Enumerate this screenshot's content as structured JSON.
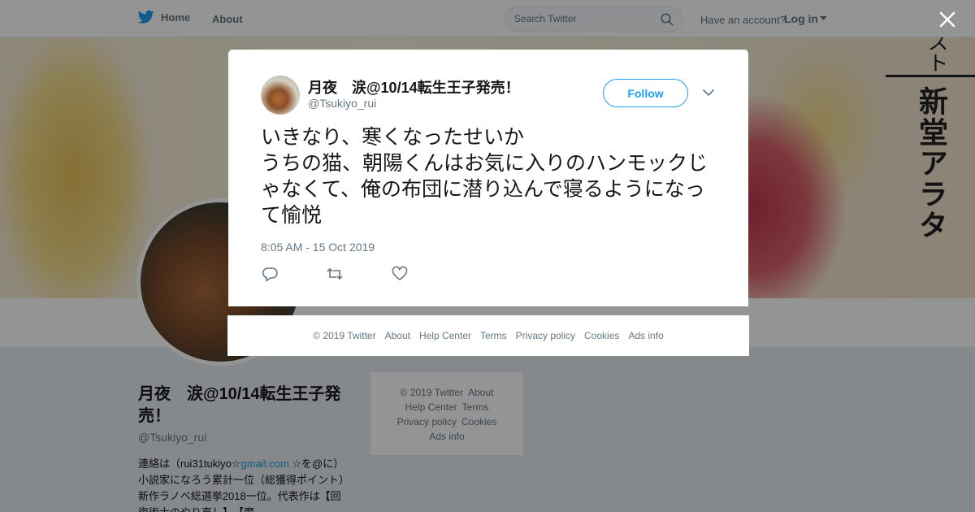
{
  "nav": {
    "home_label": "Home",
    "about_label": "About",
    "search_placeholder": "Search Twitter",
    "account_question": "Have an account?",
    "login_label": "Log in"
  },
  "banner": {
    "vertical_text": "新堂アラタ",
    "corner_text": "スト"
  },
  "profile": {
    "name": "月夜　涙@10/14転生王子発売！",
    "handle": "@Tsukiyo_rui",
    "bio_prefix": "連絡は（rui31tukiyo☆",
    "bio_link": "gmail.com",
    "bio_rest": " ☆を@に）小説家になろう累計一位（総獲得ポイント）　新作ラノベ総選挙2018一位。代表作は【回復術士のやり直し】、【魔"
  },
  "sidebar_footer": {
    "items": [
      "© 2019 Twitter",
      "About",
      "Help Center",
      "Terms",
      "Privacy policy",
      "Cookies",
      "Ads info"
    ]
  },
  "tweet": {
    "author_name": "月夜　涙@10/14転生王子発売！",
    "author_handle": "@Tsukiyo_rui",
    "follow_label": "Follow",
    "text": "いきなり、寒くなったせいか\nうちの猫、朝陽くんはお気に入りのハンモックじゃなくて、俺の布団に潜り込んで寝るようになって愉悦",
    "timestamp": "8:05 AM - 15 Oct 2019"
  },
  "modal_footer": {
    "items": [
      "© 2019 Twitter",
      "About",
      "Help Center",
      "Terms",
      "Privacy policy",
      "Cookies",
      "Ads info"
    ]
  },
  "icons": {
    "twitter_bird": "bird-icon",
    "search": "search-icon",
    "close": "close-icon",
    "caret": "chevron-down-icon",
    "reply": "reply-icon",
    "retweet": "retweet-icon",
    "like": "heart-icon"
  },
  "colors": {
    "brand": "#1da1f2",
    "link": "#1b95e0",
    "muted": "#657786"
  }
}
